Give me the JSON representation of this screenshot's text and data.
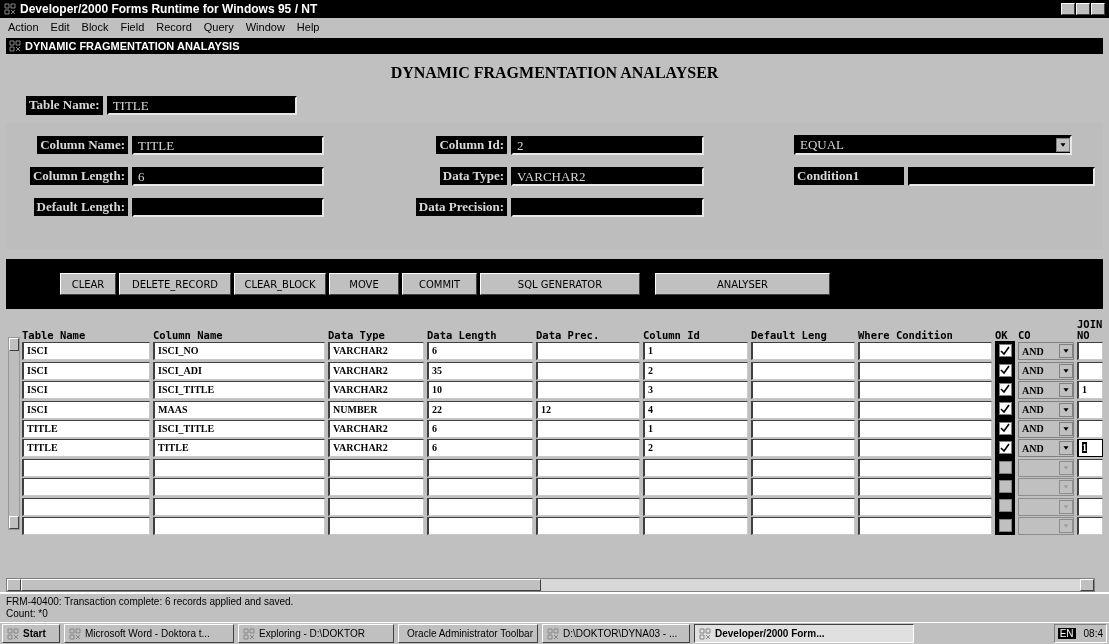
{
  "window": {
    "title": "Developer/2000 Forms Runtime for Windows 95 / NT"
  },
  "menu": [
    "Action",
    "Edit",
    "Block",
    "Field",
    "Record",
    "Query",
    "Window",
    "Help"
  ],
  "form": {
    "title": "DYNAMIC FRAGMENTATION ANALAYSIS",
    "heading": "DYNAMIC FRAGMENTATION ANALAYSER",
    "table_name": {
      "label": "Table Name:",
      "value": "TITLE"
    },
    "left_fields": [
      {
        "label": "Column Name:",
        "value": "TITLE"
      },
      {
        "label": "Column Length:",
        "value": "6"
      },
      {
        "label": "Default Length:"
      }
    ],
    "middle_fields": [
      {
        "label": "Column Id:",
        "value": "2"
      },
      {
        "label": "Data Type:",
        "value": "VARCHAR2"
      },
      {
        "label": "Data Precision:"
      }
    ],
    "condition_select": {
      "value": "EQUAL"
    },
    "condition": {
      "label": "Condition1"
    }
  },
  "buttons": [
    "CLEAR",
    "DELETE_RECORD",
    "CLEAR_BLOCK",
    "MOVE",
    "COMMIT",
    "SQL GENERATOR",
    "ANALYSER"
  ],
  "table": {
    "columns": [
      "Table Name",
      "Column Name",
      "Data Type",
      "Data Length",
      "Data Prec.",
      "Column Id",
      "Default Leng",
      "Where Condition",
      "OK",
      "CO",
      "JOIN NO"
    ],
    "rows": [
      {
        "cells": [
          "ISCI",
          "ISCI_NO",
          "VARCHAR2",
          "6",
          "",
          "1",
          "",
          ""
        ],
        "ok": true,
        "co": "AND",
        "join_no": "",
        "enabled": true,
        "selected": false
      },
      {
        "cells": [
          "ISCI",
          "ISCI_ADI",
          "VARCHAR2",
          "35",
          "",
          "2",
          "",
          ""
        ],
        "ok": true,
        "co": "AND",
        "join_no": "",
        "enabled": true,
        "selected": false
      },
      {
        "cells": [
          "ISCI",
          "ISCI_TITLE",
          "VARCHAR2",
          "10",
          "",
          "3",
          "",
          ""
        ],
        "ok": true,
        "co": "AND",
        "join_no": "1",
        "enabled": true,
        "selected": false
      },
      {
        "cells": [
          "ISCI",
          "MAAS",
          "NUMBER",
          "22",
          "12",
          "4",
          "",
          ""
        ],
        "ok": true,
        "co": "AND",
        "join_no": "",
        "enabled": true,
        "selected": false
      },
      {
        "cells": [
          "TITLE",
          "ISCI_TITLE",
          "VARCHAR2",
          "6",
          "",
          "1",
          "",
          ""
        ],
        "ok": true,
        "co": "AND",
        "join_no": "",
        "enabled": true,
        "selected": false
      },
      {
        "cells": [
          "TITLE",
          "TITLE",
          "VARCHAR2",
          "6",
          "",
          "2",
          "",
          ""
        ],
        "ok": true,
        "co": "AND",
        "join_no": "1",
        "enabled": true,
        "selected": true
      },
      {
        "cells": [
          "",
          "",
          "",
          "",
          "",
          "",
          "",
          ""
        ],
        "ok": false,
        "enabled": false,
        "selected": false
      },
      {
        "cells": [
          "",
          "",
          "",
          "",
          "",
          "",
          "",
          ""
        ],
        "ok": false,
        "enabled": false,
        "selected": false
      },
      {
        "cells": [
          "",
          "",
          "",
          "",
          "",
          "",
          "",
          ""
        ],
        "ok": false,
        "enabled": false,
        "selected": false
      },
      {
        "cells": [
          "",
          "",
          "",
          "",
          "",
          "",
          "",
          ""
        ],
        "ok": false,
        "enabled": false,
        "selected": false
      }
    ]
  },
  "status_bar": {
    "message": "FRM-40400: Transaction complete: 6 records applied and saved.",
    "count": "Count: *0"
  },
  "taskbar": {
    "start": "Start",
    "items": [
      {
        "label": "Microsoft Word - Doktora t...",
        "selected": false
      },
      {
        "label": "Exploring - D:\\DOKTOR",
        "selected": false
      },
      {
        "label": "Oracle Administrator Toolbar",
        "selected": false
      },
      {
        "label": "D:\\DOKTOR\\DYNA03 - ...",
        "selected": false
      },
      {
        "label": "Developer/2000 Form...",
        "selected": true
      }
    ],
    "language": "EN",
    "clock": "08:4"
  }
}
